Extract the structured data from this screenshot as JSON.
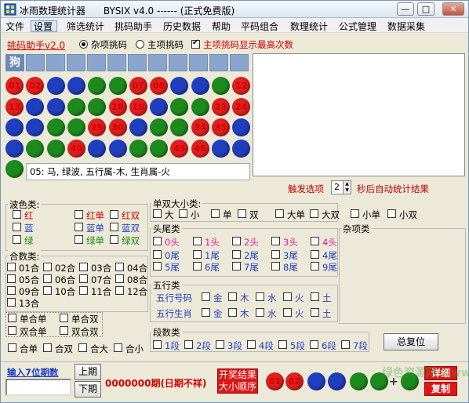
{
  "window": {
    "title": "冰雨数理统计器      BYSIX v4.0 ------ (正式免费版)",
    "min": "—",
    "max": "□",
    "close": "✕"
  },
  "menu": [
    "文件",
    "设置",
    "筛选统计",
    "挑码助手",
    "历史数据",
    "帮助",
    "平码组合",
    "数理统计",
    "公式管理",
    "数据采集"
  ],
  "toolbar": {
    "helper_title": "挑码助手v2.0",
    "radio_misc": "杂项挑码",
    "radio_main": "主项挑码",
    "checkbox_show": "主项挑码显示最高次数"
  },
  "zodiac_first": "狗",
  "balls": [
    {
      "n": "01",
      "c": "red"
    },
    {
      "n": "02",
      "c": "red"
    },
    {
      "n": "03",
      "c": "blue"
    },
    {
      "n": "04",
      "c": "blue"
    },
    {
      "n": "05",
      "c": "green"
    },
    {
      "n": "06",
      "c": "green"
    },
    {
      "n": "07",
      "c": "red"
    },
    {
      "n": "08",
      "c": "red"
    },
    {
      "n": "09",
      "c": "blue"
    },
    {
      "n": "10",
      "c": "blue"
    },
    {
      "n": "11",
      "c": "green"
    },
    {
      "n": "12",
      "c": "red"
    },
    {
      "n": "13",
      "c": "red"
    },
    {
      "n": "14",
      "c": "blue"
    },
    {
      "n": "15",
      "c": "blue"
    },
    {
      "n": "16",
      "c": "green"
    },
    {
      "n": "17",
      "c": "green"
    },
    {
      "n": "18",
      "c": "red"
    },
    {
      "n": "19",
      "c": "red"
    },
    {
      "n": "20",
      "c": "blue"
    },
    {
      "n": "21",
      "c": "green"
    },
    {
      "n": "22",
      "c": "green"
    },
    {
      "n": "23",
      "c": "red"
    },
    {
      "n": "24",
      "c": "red"
    },
    {
      "n": "25",
      "c": "blue"
    },
    {
      "n": "26",
      "c": "blue"
    },
    {
      "n": "27",
      "c": "green"
    },
    {
      "n": "28",
      "c": "green"
    },
    {
      "n": "29",
      "c": "red"
    },
    {
      "n": "30",
      "c": "red"
    },
    {
      "n": "31",
      "c": "blue"
    },
    {
      "n": "32",
      "c": "green"
    },
    {
      "n": "33",
      "c": "green"
    },
    {
      "n": "34",
      "c": "red"
    },
    {
      "n": "35",
      "c": "red"
    },
    {
      "n": "36",
      "c": "blue"
    },
    {
      "n": "37",
      "c": "blue"
    },
    {
      "n": "38",
      "c": "green"
    },
    {
      "n": "39",
      "c": "green"
    },
    {
      "n": "40",
      "c": "red"
    },
    {
      "n": "41",
      "c": "blue"
    },
    {
      "n": "42",
      "c": "blue"
    },
    {
      "n": "43",
      "c": "green"
    },
    {
      "n": "44",
      "c": "green"
    },
    {
      "n": "45",
      "c": "red"
    },
    {
      "n": "46",
      "c": "red"
    },
    {
      "n": "47",
      "c": "blue"
    },
    {
      "n": "48",
      "c": "blue"
    },
    {
      "n": "49",
      "c": "green"
    }
  ],
  "info_text": "05: 马, 绿波, 五行属-木, 生肖属-火",
  "trigger": {
    "label": "触发选项",
    "value": "2",
    "suffix": "秒后自动统计结果"
  },
  "wave": {
    "title": "波色类:",
    "items": [
      {
        "t": "红",
        "c": "red"
      },
      {
        "t": "红单",
        "c": "red"
      },
      {
        "t": "红双",
        "c": "red"
      },
      {
        "t": "蓝",
        "c": "blue"
      },
      {
        "t": "蓝单",
        "c": "blue"
      },
      {
        "t": "蓝双",
        "c": "blue"
      },
      {
        "t": "绿",
        "c": "green"
      },
      {
        "t": "绿单",
        "c": "green"
      },
      {
        "t": "绿双",
        "c": "green"
      }
    ]
  },
  "sum": {
    "title": "合数类:",
    "items": [
      "01合",
      "02合",
      "03合",
      "04合",
      "05合",
      "06合",
      "07合",
      "08合",
      "09合",
      "10合",
      "11合",
      "12合",
      "13合"
    ]
  },
  "sumoe": [
    "单合单",
    "单合双",
    "双合单",
    "双合双"
  ],
  "sumsize": [
    "合单",
    "合双",
    "合大",
    "合小"
  ],
  "oddeven": {
    "title": "单双大小类:",
    "items": [
      "大",
      "小",
      "单",
      "双",
      "大单",
      "大双",
      "小单",
      "小双"
    ]
  },
  "head": {
    "title": "头尾类",
    "heads": [
      "0头",
      "1头",
      "2头",
      "3头",
      "4头"
    ],
    "tails": [
      "0尾",
      "1尾",
      "2尾",
      "3尾",
      "4尾",
      "5尾",
      "6尾",
      "7尾",
      "8尾",
      "9尾"
    ]
  },
  "misc_title": "杂项类",
  "wuxing": {
    "title": "五行类",
    "row1": "五行号码",
    "row2": "五行生肖",
    "items": [
      "金",
      "木",
      "水",
      "火",
      "土"
    ]
  },
  "segments": {
    "title": "段数类",
    "items": [
      "1段",
      "2段",
      "3段",
      "4段",
      "5段",
      "6段",
      "7段"
    ]
  },
  "reset": "总复位",
  "bottom": {
    "input_label": "输入7位期数",
    "prev": "上期",
    "next": "下期",
    "period_text": "0000000期(日期不祥)",
    "order_line1": "开奖结果",
    "order_line2": "大小顺序",
    "result_balls": [
      {
        "n": "01",
        "c": "red"
      },
      {
        "n": "02",
        "c": "red"
      },
      {
        "n": "03",
        "c": "blue"
      },
      {
        "n": "04",
        "c": "blue"
      },
      {
        "n": "05",
        "c": "green"
      },
      {
        "n": "05",
        "c": "green"
      },
      {
        "n": "06",
        "c": "green"
      }
    ],
    "plus": "+",
    "detail": "详细",
    "copy": "复制"
  },
  "watermark": "绿色资源网 www.downcc.com"
}
